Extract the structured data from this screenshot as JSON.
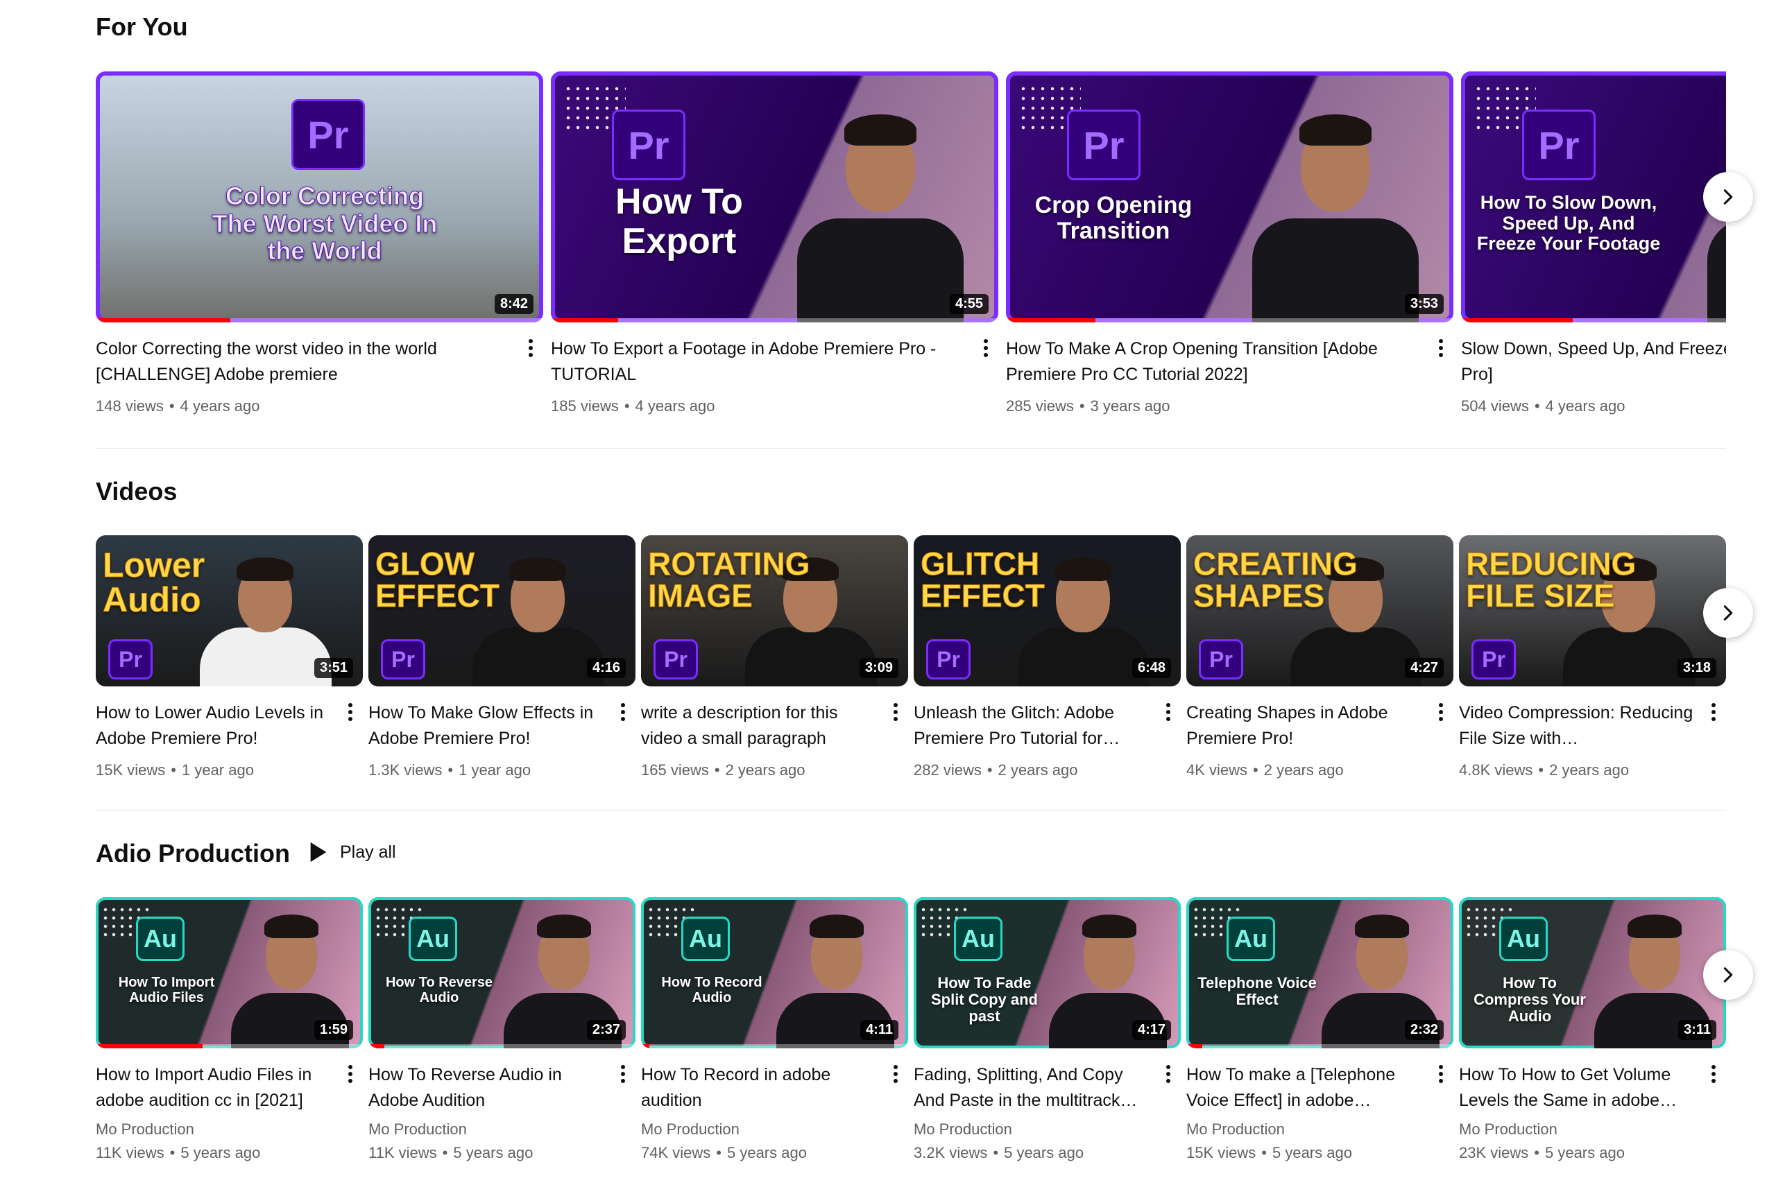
{
  "sections": [
    {
      "title": "For You",
      "play_all": null,
      "videos": [
        {
          "title": "Color Correcting the worst video in the world [CHALLENGE] Adobe premiere",
          "views": "148 views",
          "age": "4 years ago",
          "duration": "8:42",
          "thumb_text": "Color Correcting The Worst Video In the World",
          "thumb_badge": "Pr"
        },
        {
          "title": "How To Export a Footage in Adobe Premiere Pro - TUTORIAL",
          "views": "185 views",
          "age": "4 years ago",
          "duration": "4:55",
          "thumb_text": "How To Export",
          "thumb_badge": "Pr"
        },
        {
          "title": "How To Make A Crop Opening Transition [Adobe Premiere Pro CC Tutorial 2022]",
          "views": "285 views",
          "age": "3 years ago",
          "duration": "3:53",
          "thumb_text": "Crop Opening Transition",
          "thumb_badge": "Pr"
        },
        {
          "title": "Slow Down, Speed Up, And Freeze [Adobe Premiere Pro]",
          "views": "504 views",
          "age": "4 years ago",
          "duration": "",
          "thumb_text": "How To Slow Down, Speed Up, And Freeze Your Footage",
          "thumb_badge": "Pr"
        }
      ]
    },
    {
      "title": "Videos",
      "play_all": null,
      "videos": [
        {
          "title": "How to Lower Audio Levels in Adobe Premiere Pro!",
          "views": "15K views",
          "age": "1 year ago",
          "duration": "3:51",
          "thumb_text": "Lower Audio",
          "thumb_badge": "Pr"
        },
        {
          "title": "How To Make Glow Effects in Adobe Premiere Pro!",
          "views": "1.3K views",
          "age": "1 year ago",
          "duration": "4:16",
          "thumb_text": "GLOW EFFECT",
          "thumb_badge": "Pr"
        },
        {
          "title": "write a description for this video a small paragraph",
          "views": "165 views",
          "age": "2 years ago",
          "duration": "3:09",
          "thumb_text": "ROTATING IMAGE",
          "thumb_badge": "Pr"
        },
        {
          "title": "Unleash the Glitch: Adobe Premiere Pro Tutorial for…",
          "views": "282 views",
          "age": "2 years ago",
          "duration": "6:48",
          "thumb_text": "GLITCH EFFECT",
          "thumb_badge": "Pr"
        },
        {
          "title": "Creating Shapes in Adobe Premiere Pro!",
          "views": "4K views",
          "age": "2 years ago",
          "duration": "4:27",
          "thumb_text": "CREATING SHAPES",
          "thumb_badge": "Pr"
        },
        {
          "title": "Video Compression: Reducing File Size with…",
          "views": "4.8K views",
          "age": "2 years ago",
          "duration": "3:18",
          "thumb_text": "REDUCING FILE SIZE",
          "thumb_badge": "Pr"
        }
      ]
    },
    {
      "title": "Adio Production",
      "play_all": "Play all",
      "videos": [
        {
          "title": "How to Import Audio Files in adobe audition cc in [2021]",
          "channel": "Mo Production",
          "views": "11K views",
          "age": "5 years ago",
          "duration": "1:59",
          "thumb_text": "How To Import Audio Files",
          "thumb_badge": "Au"
        },
        {
          "title": "How To Reverse Audio in Adobe Audition",
          "channel": "Mo Production",
          "views": "11K views",
          "age": "5 years ago",
          "duration": "2:37",
          "thumb_text": "How To Reverse Audio",
          "thumb_badge": "Au"
        },
        {
          "title": "How To Record in adobe audition",
          "channel": "Mo Production",
          "views": "74K views",
          "age": "5 years ago",
          "duration": "4:11",
          "thumb_text": "How To Record Audio",
          "thumb_badge": "Au"
        },
        {
          "title": "Fading, Splitting, And Copy And Paste in the multitrack…",
          "channel": "Mo Production",
          "views": "3.2K views",
          "age": "5 years ago",
          "duration": "4:17",
          "thumb_text": "How To Fade Split Copy and past",
          "thumb_badge": "Au"
        },
        {
          "title": "How To make a [Telephone Voice Effect] in adobe…",
          "channel": "Mo Production",
          "views": "15K views",
          "age": "5 years ago",
          "duration": "2:32",
          "thumb_text": "Telephone Voice Effect",
          "thumb_badge": "Au"
        },
        {
          "title": "How To How to Get Volume Levels the Same in adobe…",
          "channel": "Mo Production",
          "views": "23K views",
          "age": "5 years ago",
          "duration": "3:11",
          "thumb_text": "How To Compress Your Audio",
          "thumb_badge": "Au"
        }
      ]
    }
  ],
  "colors": {
    "accent_red": "#ff0000",
    "premiere_purple": "#6a1fd1",
    "audition_teal": "#2ad6c4",
    "text_primary": "#0f0f0f",
    "text_secondary": "#606060"
  },
  "icons": {
    "next": "chevron-right-icon",
    "more": "more-vert-icon",
    "play": "play-icon"
  }
}
